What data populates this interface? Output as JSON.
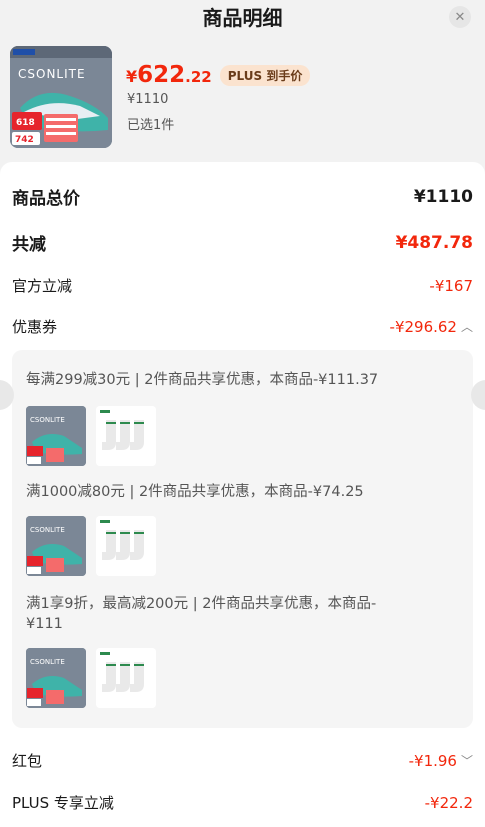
{
  "header": {
    "title": "商品明细",
    "close_icon": "close-icon"
  },
  "product": {
    "price_currency": "¥",
    "price_int": "622",
    "price_dec": ".22",
    "plus_tag": "PLUS 到手价",
    "original_price": "¥1110",
    "selected": "已选1件",
    "image_logo_text": "CSONLITE",
    "image_badge_618": "618",
    "image_badge_price": "742"
  },
  "summary": [
    {
      "label": "商品总价",
      "value": "¥1110"
    },
    {
      "label": "共减",
      "value": "¥487.78"
    },
    {
      "label": "官方立减",
      "value": "-¥167"
    },
    {
      "label": "优惠券",
      "value": "-¥296.62"
    }
  ],
  "coupons": [
    {
      "text": "每满299减30元 | 2件商品共享优惠，本商品-¥111.37"
    },
    {
      "text": "满1000减80元 | 2件商品共享优惠，本商品-¥74.25"
    },
    {
      "text": "满1享9折，最高减200元 | 2件商品共享优惠，本商品-¥111"
    }
  ],
  "bottom": [
    {
      "label": "红包",
      "value": "-¥1.96"
    },
    {
      "label": "PLUS 专享立减",
      "value": "-¥22.2"
    }
  ],
  "colors": {
    "accent": "#f2270c",
    "plus_bg": "#fbe3cf"
  }
}
